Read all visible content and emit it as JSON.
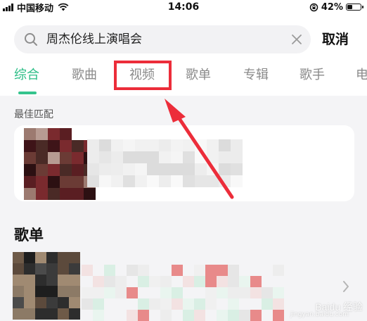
{
  "status_bar": {
    "carrier": "中国移动",
    "time": "14:06",
    "battery": "42%",
    "battery_level": 0.42
  },
  "search": {
    "query": "周杰伦线上演唱会",
    "cancel_label": "取消"
  },
  "tabs": [
    "综合",
    "歌曲",
    "视频",
    "歌单",
    "专辑",
    "歌手",
    "电"
  ],
  "active_tab": "综合",
  "highlighted_tab": "视频",
  "sections": {
    "best_match_label": "最佳匹配",
    "playlist_title": "歌单"
  },
  "watermark": {
    "brand": "Baidu 经验",
    "url": "jingyan.baidu.com"
  },
  "colors": {
    "accent": "#2bbd86",
    "annotation": "#ec2d3a"
  }
}
